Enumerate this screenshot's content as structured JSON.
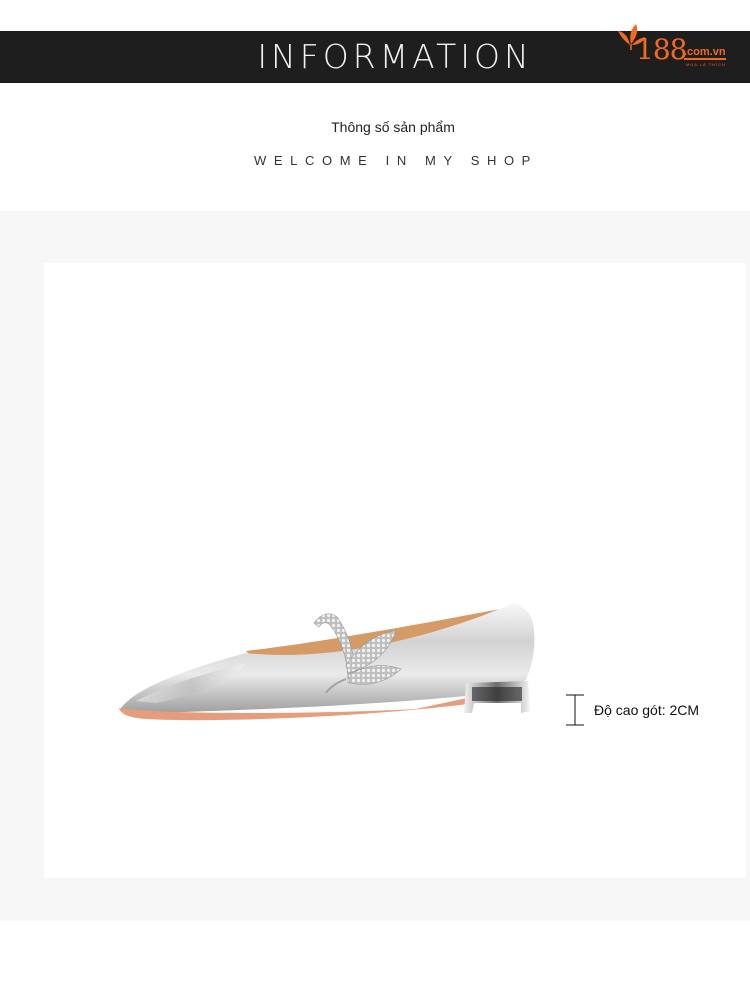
{
  "header": {
    "title": "INFORMATION",
    "logo": {
      "number": "188",
      "domain": ".com.vn",
      "tagline": "MUA LÀ THÍCH",
      "brand_color": "#f26a21"
    },
    "background_color": "#1e1e1e"
  },
  "intro": {
    "subtitle_vi": "Thông số sản phẩm",
    "subtitle_en": "WELCOME IN MY SHOP"
  },
  "product": {
    "heel_height_label": "Độ cao gót: 2CM",
    "image_icon": "shoe-image",
    "measure_icon": "height-measure-icon",
    "panel_color": "#f7f7f7"
  }
}
